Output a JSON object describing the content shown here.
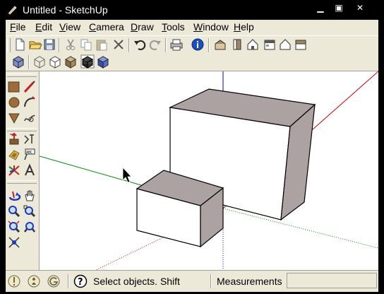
{
  "window": {
    "title": "Untitled - SketchUp",
    "minimize_label": "▁",
    "maximize_label": "▣",
    "close_label": "✕"
  },
  "menu": [
    {
      "label": "File",
      "ul": "F",
      "rest": "ile"
    },
    {
      "label": "Edit",
      "ul": "E",
      "rest": "dit"
    },
    {
      "label": "View",
      "ul": "V",
      "rest": "iew"
    },
    {
      "label": "Camera",
      "ul": "C",
      "rest": "amera"
    },
    {
      "label": "Draw",
      "ul": "D",
      "rest": "raw"
    },
    {
      "label": "Tools",
      "ul": "T",
      "rest": "ools"
    },
    {
      "label": "Window",
      "ul": "W",
      "rest": "indow"
    },
    {
      "label": "Help",
      "ul": "H",
      "rest": "elp"
    }
  ],
  "toolbar_top": [
    "new-icon",
    "open-icon",
    "save-icon",
    "cut-icon",
    "copy-icon",
    "paste-icon",
    "erase-icon",
    "undo-icon",
    "redo-icon",
    "print-icon",
    "model-info-icon",
    "iso-view-icon",
    "top-view-icon",
    "front-view-icon",
    "right-view-icon",
    "back-view-icon",
    "left-view-icon"
  ],
  "toolbar_styles": [
    "xray-icon",
    "wireframe-icon",
    "hidden-line-icon",
    "shaded-icon",
    "shaded-textures-icon",
    "monochrome-icon"
  ],
  "left_tools": [
    "rectangle-icon",
    "line-icon",
    "circle-icon",
    "arc-icon",
    "polygon-icon",
    "freehand-icon",
    "push-pull-icon",
    "follow-me-icon",
    "offset-icon",
    "tape-measure-icon",
    "dimension-icon",
    "text-icon",
    "axes-icon",
    "3d-text-icon",
    "orbit-icon",
    "pan-icon",
    "zoom-icon",
    "zoom-window-icon",
    "zoom-extents-icon",
    "previous-view-icon",
    "position-camera-icon"
  ],
  "status": {
    "text": "Select objects. Shift",
    "measurements_label": "Measurements",
    "measurements_value": "",
    "icons": [
      "geo-location-icon",
      "credits-icon",
      "google-sign-in-icon",
      "help-icon"
    ]
  },
  "colors": {
    "chrome": "#ece9d8",
    "face": "#aca2a1",
    "axis_red": "#cc0000",
    "axis_green": "#008800",
    "axis_blue": "#0000cc"
  }
}
